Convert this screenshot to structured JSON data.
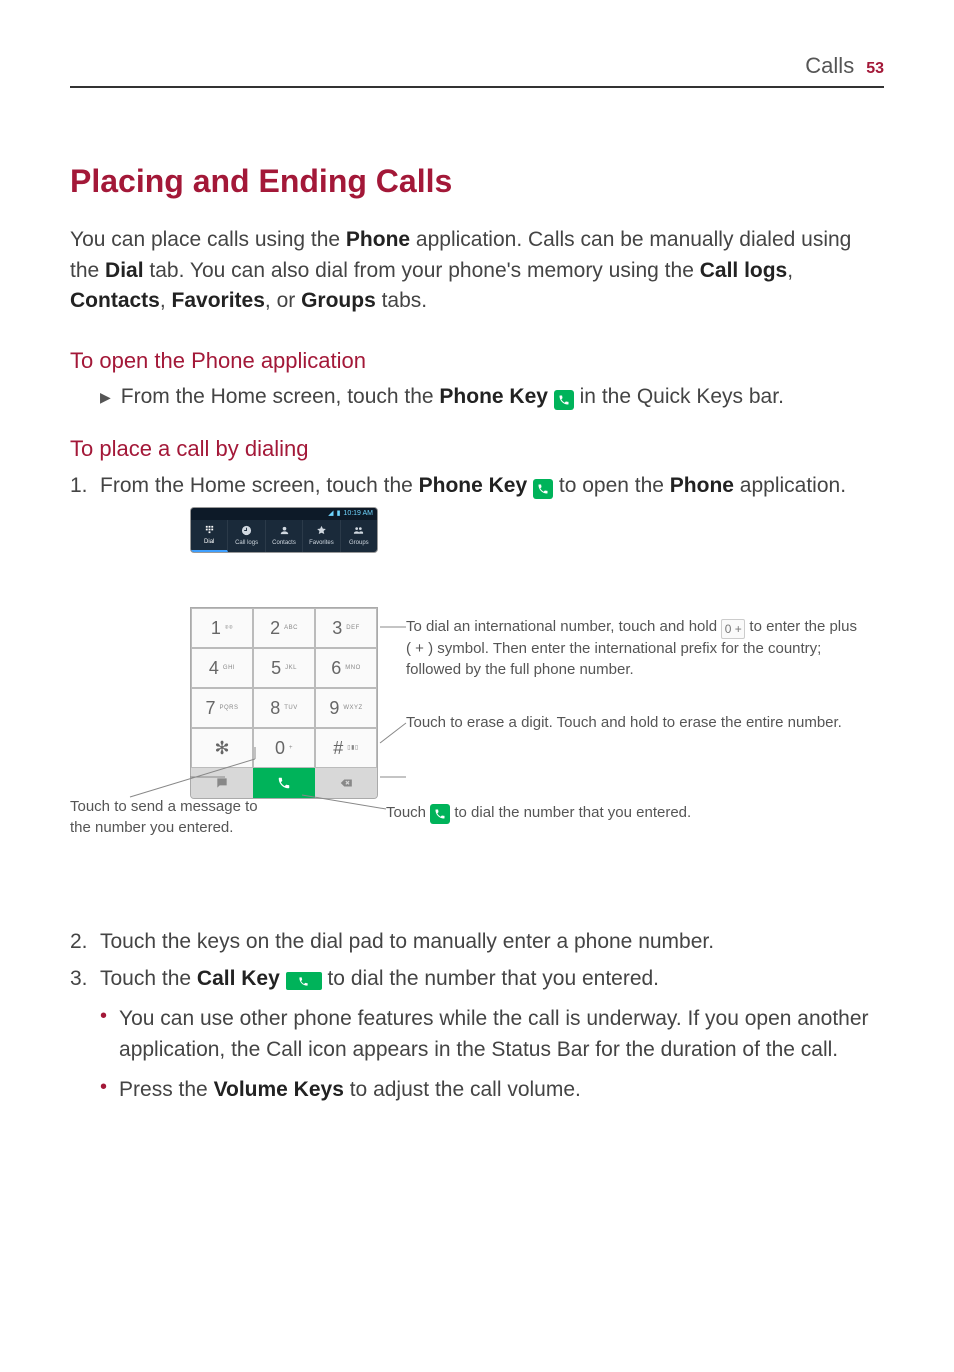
{
  "header": {
    "section": "Calls",
    "page": "53"
  },
  "h1": "Placing and Ending Calls",
  "intro_parts": {
    "a": "You can place calls using the ",
    "b_strong": "Phone",
    "c": " application. Calls can be manually dialed using the ",
    "d_strong": "Dial",
    "e": " tab. You can also dial from your phone's memory using the ",
    "f_strong": "Call logs",
    "g": ", ",
    "h_strong": "Contacts",
    "i": ", ",
    "j_strong": "Favorites",
    "k": ", or ",
    "l_strong": "Groups",
    "m": " tabs."
  },
  "sub1": "To open the Phone application",
  "step1_parts": {
    "a": "From the Home screen, touch the ",
    "b_strong": "Phone Key",
    "c": " in the Quick Keys bar."
  },
  "sub2": "To place a call by dialing",
  "dialstep1": {
    "num": "1.",
    "a": "From the Home screen, touch the ",
    "b_strong": "Phone Key",
    "c": " to open the ",
    "d_strong": "Phone",
    "e": " application."
  },
  "status_time": "10:19 AM",
  "tabs": {
    "dial": "Dial",
    "calllogs": "Call logs",
    "contacts": "Contacts",
    "favorites": "Favorites",
    "groups": "Groups"
  },
  "keys": {
    "k1n": "1",
    "k1l": "  ",
    "k2n": "2",
    "k2l": "ABC",
    "k3n": "3",
    "k3l": "DEF",
    "k4n": "4",
    "k4l": "GHI",
    "k5n": "5",
    "k5l": "JKL",
    "k6n": "6",
    "k6l": "MNO",
    "k7n": "7",
    "k7l": "PQRS",
    "k8n": "8",
    "k8l": "TUV",
    "k9n": "9",
    "k9l": "WXYZ",
    "kstar": "✻",
    "k0n": "0",
    "k0l": "+",
    "khash": "#",
    "khashicon": ""
  },
  "callout_intl": {
    "a": "To dial an international number, touch and hold ",
    "zero": "0 +",
    "b": " to enter the plus ( + ) symbol. Then enter the international prefix for the country; followed by the full phone number."
  },
  "callout_erase": "Touch to erase a digit. Touch and hold to erase the entire number.",
  "callout_dial": {
    "a": "Touch ",
    "b": " to dial the number that you entered."
  },
  "callout_msg": "Touch to send a message to the number you entered.",
  "dialstep2": {
    "num": "2.",
    "text": "Touch the keys on the dial pad to manually enter a phone number."
  },
  "dialstep3": {
    "num": "3.",
    "a": "Touch the ",
    "b_strong": "Call Key",
    "c": " to dial the number that you entered."
  },
  "bullet1": "You can use other phone features while the call is underway. If you open another application, the Call icon appears in the Status Bar for the duration of the call.",
  "bullet2": {
    "a": "Press the ",
    "b_strong": "Volume Keys",
    "c": " to adjust the call volume."
  }
}
